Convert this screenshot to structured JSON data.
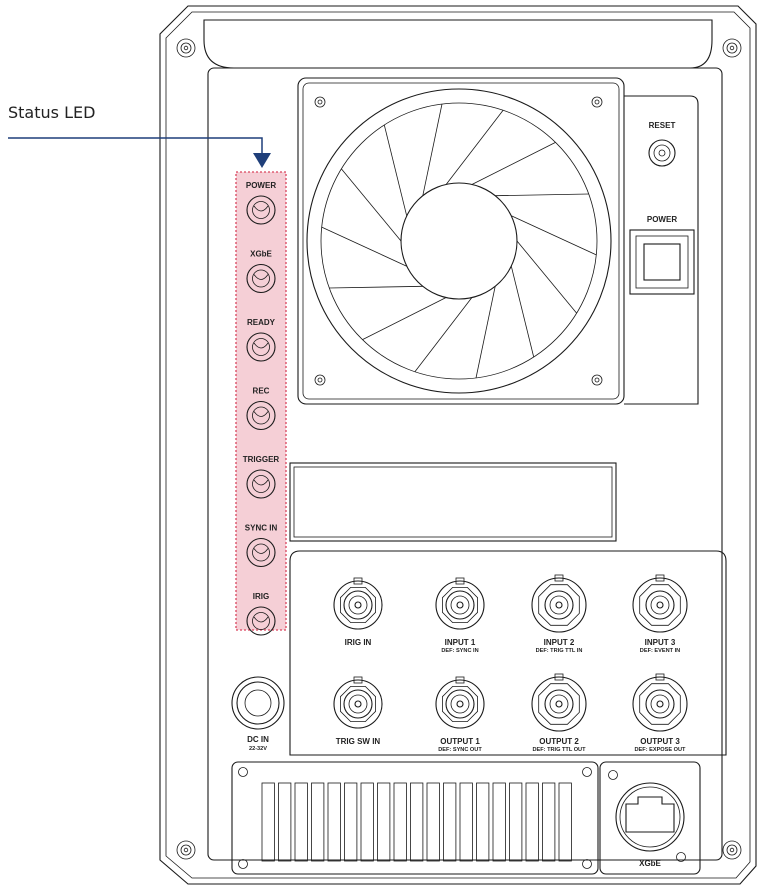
{
  "callout": {
    "label": "Status LED",
    "accent": "#1f3f7a"
  },
  "highlight": {
    "fill": "#f5cfd6",
    "border": "#d9455e"
  },
  "status_leds": [
    {
      "id": "power",
      "label": "POWER"
    },
    {
      "id": "xgbe",
      "label": "XGbE"
    },
    {
      "id": "ready",
      "label": "READY"
    },
    {
      "id": "rec",
      "label": "REC"
    },
    {
      "id": "trigger",
      "label": "TRIGGER"
    },
    {
      "id": "sync-in",
      "label": "SYNC IN"
    },
    {
      "id": "irig",
      "label": "IRIG"
    }
  ],
  "buttons": {
    "reset": "RESET",
    "power": "POWER"
  },
  "connectors": [
    {
      "id": "irig-in",
      "label": "IRIG IN",
      "sub": ""
    },
    {
      "id": "input-1",
      "label": "INPUT 1",
      "sub": "DEF: SYNC IN"
    },
    {
      "id": "input-2",
      "label": "INPUT 2",
      "sub": "DEF: TRIG TTL IN"
    },
    {
      "id": "input-3",
      "label": "INPUT 3",
      "sub": "DEF: EVENT IN"
    },
    {
      "id": "trig-sw-in",
      "label": "TRIG SW IN",
      "sub": ""
    },
    {
      "id": "output-1",
      "label": "OUTPUT 1",
      "sub": "DEF: SYNC OUT"
    },
    {
      "id": "output-2",
      "label": "OUTPUT 2",
      "sub": "DEF: TRIG TTL OUT"
    },
    {
      "id": "output-3",
      "label": "OUTPUT 3",
      "sub": "DEF: EXPOSE OUT"
    }
  ],
  "dc_in": {
    "label": "DC IN",
    "sub": "22-32V"
  },
  "xgbe_port": {
    "label": "XGbE"
  }
}
